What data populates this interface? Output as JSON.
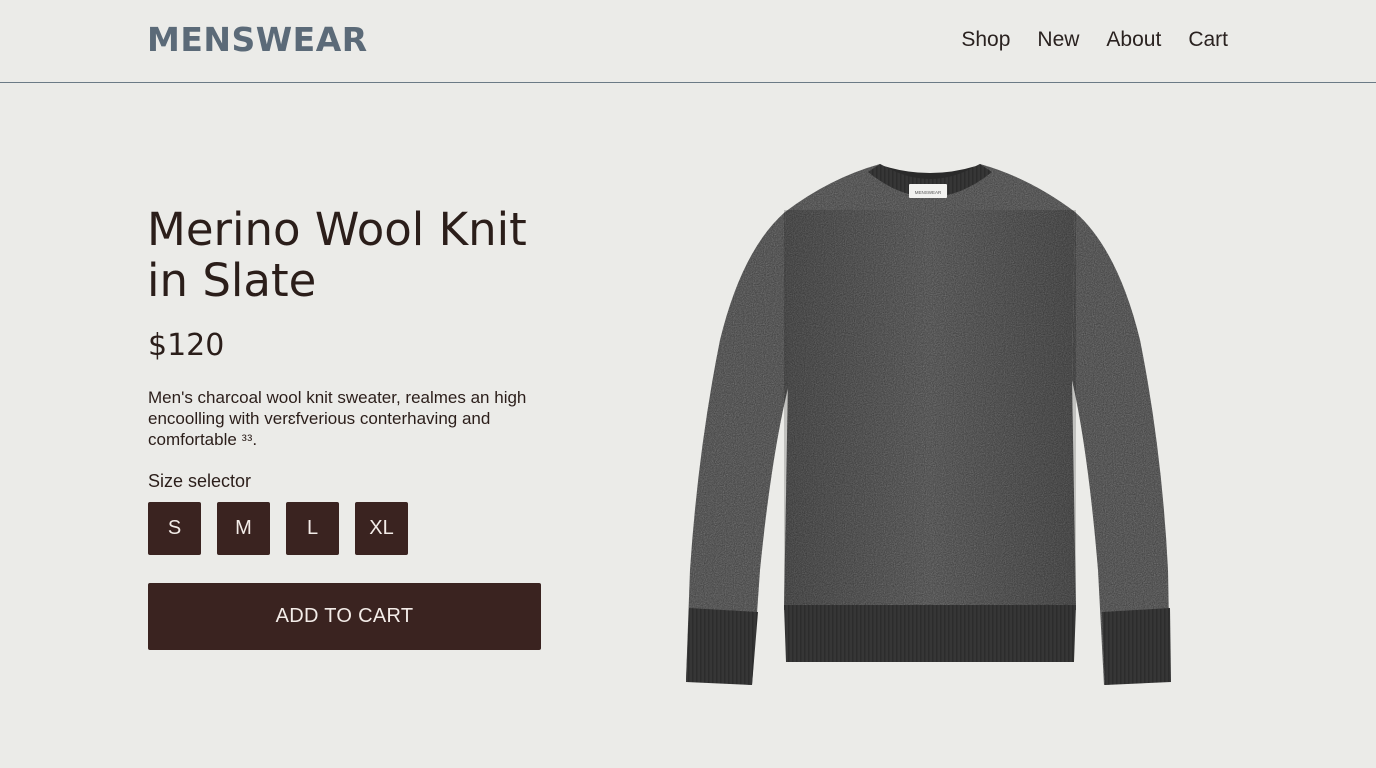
{
  "header": {
    "logo": "MENSWEAR",
    "nav": [
      "Shop",
      "New",
      "About",
      "Cart"
    ]
  },
  "product": {
    "title": "Merino Wool Knit in Slate",
    "price": "$120",
    "description": "Men's charcoal wool knit sweater, realmes an high encoolling with verɛfverious conterhaving and comfortable ᵌᵌ.",
    "size_label": "Size selector",
    "sizes": [
      "S",
      "M",
      "L",
      "XL"
    ],
    "add_to_cart_label": "ADD TO CART",
    "image_tag_text": "MENSWEAR"
  },
  "colors": {
    "background": "#ebebe8",
    "logo": "#5b6a78",
    "button": "#3a2320",
    "button_text": "#f3ece8",
    "sweater": "#3c3c3c"
  }
}
